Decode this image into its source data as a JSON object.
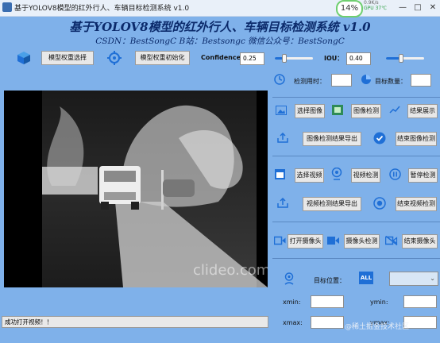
{
  "window": {
    "title": "基于YOLOV8模型的红外行人、车辆目标检测系统 v1.0",
    "minimize": "—",
    "maximize": "□",
    "close": "✕",
    "perf_percent": "14%",
    "perf_line1": "0.9K/s",
    "perf_line2": "GPU 37℃"
  },
  "header": {
    "title": "基于YOLOV8模型的红外行人、车辆目标检测系统 v1.0",
    "credits": "CSDN：BestSongC   B站：Bestsongc   微信公众号：BestSongC"
  },
  "toolbar": {
    "select_weights": "模型权重选择",
    "init_weights": "模型权重初始化",
    "confidence_label": "Confidence:",
    "confidence_value": "0.25",
    "confidence_level": 0.25,
    "iou_label": "IOU：",
    "iou_value": "0.40",
    "iou_level": 0.4
  },
  "stats": {
    "time_label": "检测用时：",
    "count_label": "目标数量："
  },
  "image_section": {
    "select": "选择图像",
    "detect": "图像检测",
    "show_result": "结果展示",
    "export": "图像检测结果导出",
    "end": "结束图像检测"
  },
  "video_section": {
    "select": "选择视频",
    "detect": "视频检测",
    "pause": "暂停检测",
    "export": "视频检测结果导出",
    "end": "结束视频检测"
  },
  "camera_section": {
    "open": "打开摄像头",
    "detect": "摄像头检测",
    "end": "结束摄像头"
  },
  "target": {
    "position_label": "目标位置：",
    "all_badge": "ALL",
    "xmin": "xmin:",
    "ymin": "ymin:",
    "xmax": "xmax:",
    "ymax": "ymax:"
  },
  "video_overlay": {
    "watermark": "clideo.com"
  },
  "status": {
    "message": "成功打开视频！！"
  },
  "footer_watermark": "@稀土掘金技术社区",
  "colors": {
    "background": "#7fb1ea",
    "title": "#0b2a6b",
    "accent": "#1f6fd6"
  }
}
